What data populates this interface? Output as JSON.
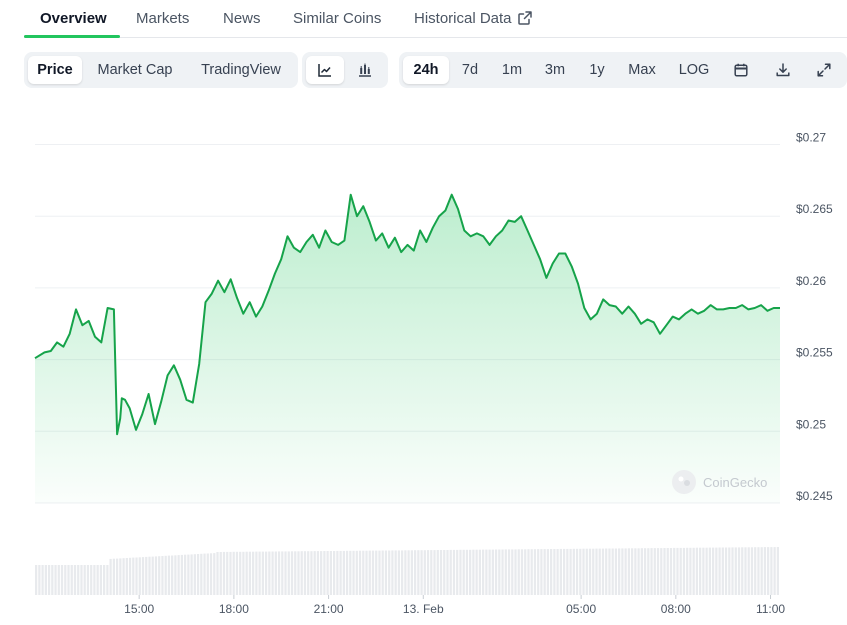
{
  "tabs": [
    {
      "label": "Overview",
      "active": true
    },
    {
      "label": "Markets"
    },
    {
      "label": "News"
    },
    {
      "label": "Similar Coins"
    },
    {
      "label": "Historical Data",
      "icon": "external-link-icon"
    }
  ],
  "toolbar": {
    "chart_modes": [
      "Price",
      "Market Cap",
      "TradingView"
    ],
    "selected_mode": "Price",
    "chart_styles": [
      {
        "icon": "line-chart-icon",
        "selected": true
      },
      {
        "icon": "candlestick-chart-icon"
      }
    ],
    "ranges": [
      "24h",
      "7d",
      "1m",
      "3m",
      "1y",
      "Max",
      "LOG"
    ],
    "selected_range": "24h",
    "tools": [
      "calendar-icon",
      "download-icon",
      "expand-icon"
    ]
  },
  "watermark": "CoinGecko",
  "chart_data": {
    "type": "area",
    "line_color": "#16a34a",
    "y_ticks": [
      "$0.27",
      "$0.265",
      "$0.26",
      "$0.255",
      "$0.25",
      "$0.245"
    ],
    "ylim": [
      0.245,
      0.27
    ],
    "x_ticks": [
      "15:00",
      "18:00",
      "21:00",
      "13. Feb",
      "05:00",
      "08:00",
      "11:00"
    ],
    "x_tick_hours": [
      3,
      6,
      9,
      12,
      17,
      20,
      23
    ],
    "x_range_hours": [
      -0.3,
      23.3
    ],
    "grid": true,
    "volume_bars": true,
    "series": [
      {
        "x": [
          -0.3,
          0.0,
          0.2,
          0.4,
          0.6,
          0.8,
          1.0,
          1.2,
          1.4,
          1.6,
          1.8,
          2.0,
          2.2,
          2.3,
          2.4,
          2.45,
          2.55,
          2.7,
          2.9,
          3.1,
          3.3,
          3.5,
          3.7,
          3.9,
          4.1,
          4.3,
          4.5,
          4.7,
          4.9,
          5.1,
          5.3,
          5.5,
          5.7,
          5.9,
          6.1,
          6.3,
          6.5,
          6.7,
          6.9,
          7.1,
          7.3,
          7.5,
          7.7,
          7.9,
          8.1,
          8.3,
          8.5,
          8.7,
          8.9,
          9.1,
          9.3,
          9.5,
          9.7,
          9.9,
          10.1,
          10.3,
          10.5,
          10.7,
          10.9,
          11.1,
          11.3,
          11.5,
          11.7,
          11.9,
          12.1,
          12.3,
          12.5,
          12.7,
          12.9,
          13.1,
          13.3,
          13.5,
          13.7,
          13.9,
          14.1,
          14.3,
          14.5,
          14.7,
          14.9,
          15.1,
          15.3,
          15.5,
          15.7,
          15.9,
          16.1,
          16.3,
          16.5,
          16.7,
          16.9,
          17.1,
          17.3,
          17.5,
          17.7,
          17.9,
          18.1,
          18.3,
          18.5,
          18.7,
          18.9,
          19.1,
          19.3,
          19.5,
          19.7,
          19.9,
          20.1,
          20.3,
          20.5,
          20.7,
          20.9,
          21.1,
          21.3,
          21.5,
          21.7,
          21.9,
          22.1,
          22.3,
          22.5,
          22.7,
          22.9,
          23.1,
          23.3
        ],
        "values": [
          0.2551,
          0.2555,
          0.2556,
          0.2562,
          0.2559,
          0.2568,
          0.2585,
          0.2574,
          0.2577,
          0.2566,
          0.2562,
          0.2586,
          0.2585,
          0.2498,
          0.2509,
          0.2523,
          0.2522,
          0.2516,
          0.2501,
          0.2512,
          0.2526,
          0.2505,
          0.2521,
          0.2539,
          0.2546,
          0.2536,
          0.2522,
          0.252,
          0.2547,
          0.259,
          0.2596,
          0.2605,
          0.2597,
          0.2606,
          0.2593,
          0.2582,
          0.259,
          0.258,
          0.2587,
          0.2598,
          0.261,
          0.262,
          0.2636,
          0.2628,
          0.2625,
          0.2632,
          0.2637,
          0.2628,
          0.264,
          0.2632,
          0.263,
          0.2633,
          0.2665,
          0.265,
          0.2657,
          0.2646,
          0.2633,
          0.2638,
          0.2628,
          0.2635,
          0.2625,
          0.263,
          0.2626,
          0.264,
          0.2632,
          0.2642,
          0.265,
          0.2654,
          0.2665,
          0.2655,
          0.264,
          0.2636,
          0.2638,
          0.2636,
          0.263,
          0.2636,
          0.264,
          0.2647,
          0.2646,
          0.265,
          0.264,
          0.263,
          0.262,
          0.2607,
          0.2617,
          0.2624,
          0.2624,
          0.2615,
          0.2603,
          0.2586,
          0.2578,
          0.2582,
          0.2592,
          0.2588,
          0.2587,
          0.2582,
          0.2587,
          0.2582,
          0.2575,
          0.2578,
          0.2576,
          0.2568,
          0.2574,
          0.258,
          0.2578,
          0.2582,
          0.2585,
          0.2582,
          0.2584,
          0.2588,
          0.2585,
          0.2585,
          0.2586,
          0.2586,
          0.2588,
          0.2585,
          0.2586,
          0.2588,
          0.2584,
          0.2586,
          0.2586
        ]
      }
    ]
  }
}
